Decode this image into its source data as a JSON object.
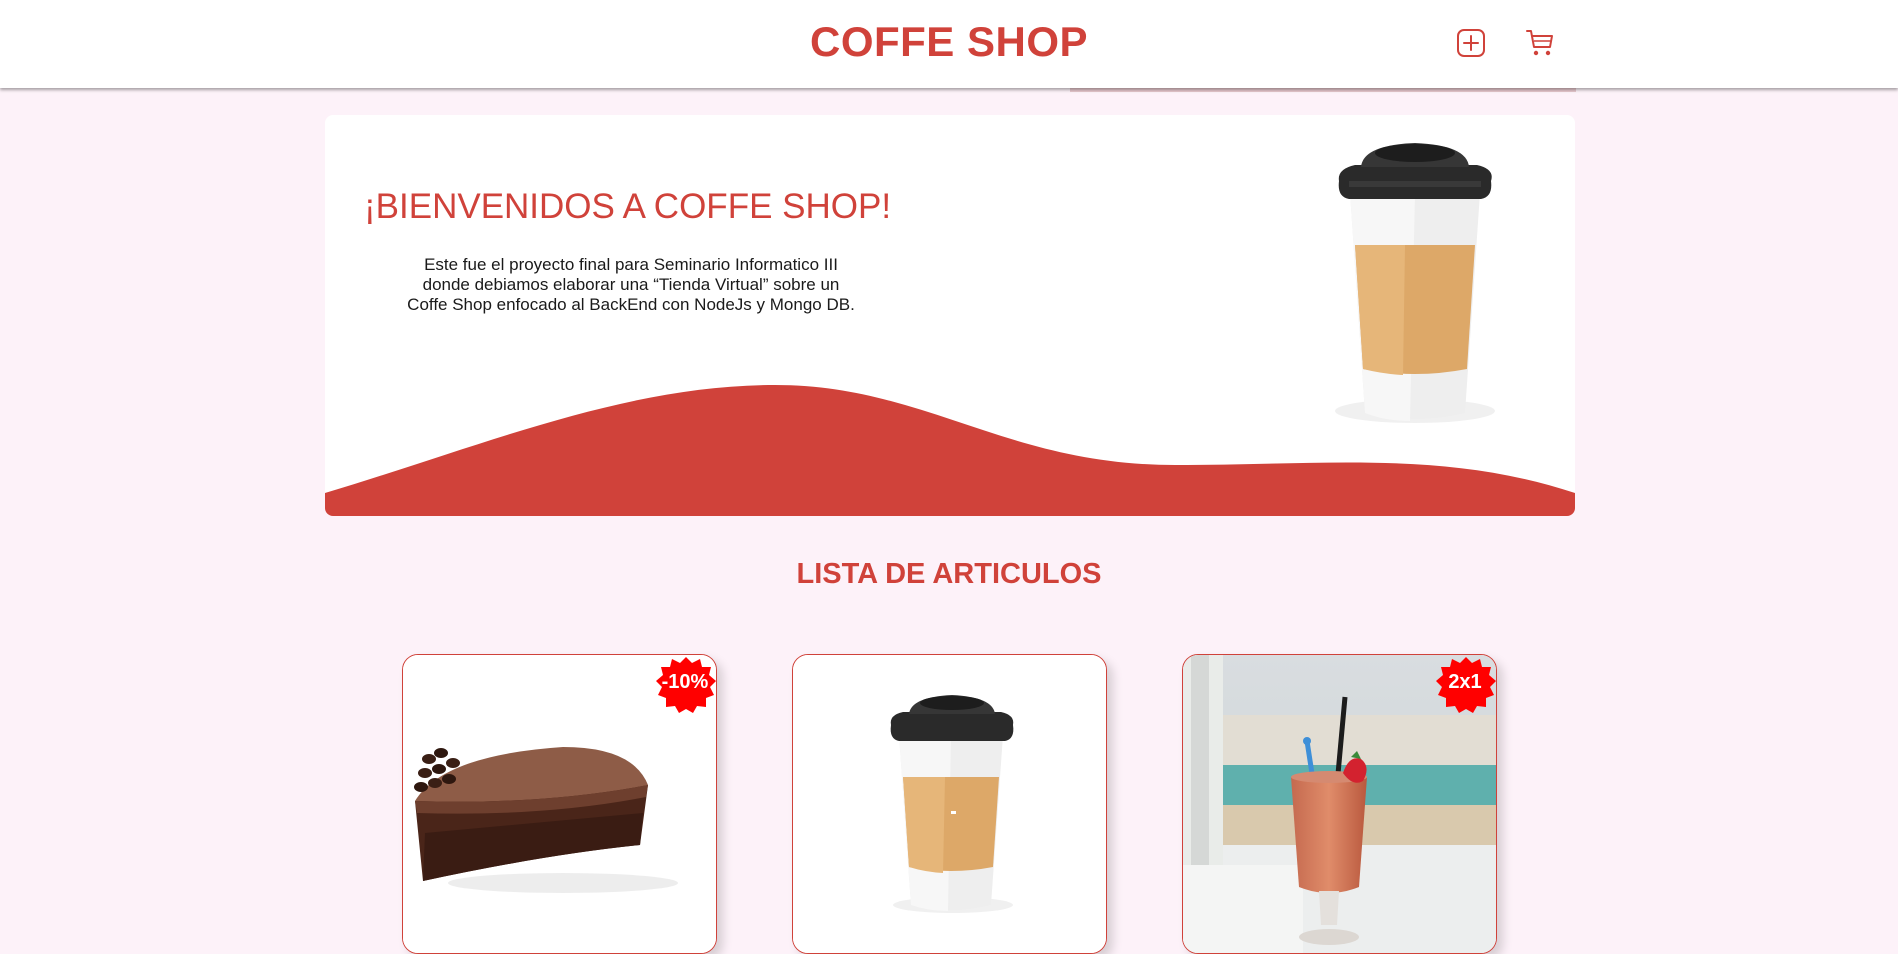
{
  "header": {
    "title": "COFFE SHOP",
    "add_icon": "plus-square-icon",
    "cart_icon": "shopping-cart-icon"
  },
  "hero": {
    "title": "¡BIENVENIDOS A COFFE SHOP!",
    "description": "Este fue el proyecto final para Seminario Informatico III donde debiamos elaborar una “Tienda Virtual” sobre un Coffe Shop enfocado al BackEnd con NodeJs y Mongo DB.",
    "image": "coffee-cup-image"
  },
  "products_section": {
    "title": "LISTA DE ARTICULOS"
  },
  "products": [
    {
      "image": "chocolate-cake-slice-image",
      "badge": "-10%"
    },
    {
      "image": "coffee-cup-image",
      "badge": ""
    },
    {
      "image": "strawberry-smoothie-image",
      "badge": "2x1"
    }
  ],
  "colors": {
    "accent": "#d0423a",
    "background": "#fdf2f9",
    "badge": "#ff0000"
  }
}
